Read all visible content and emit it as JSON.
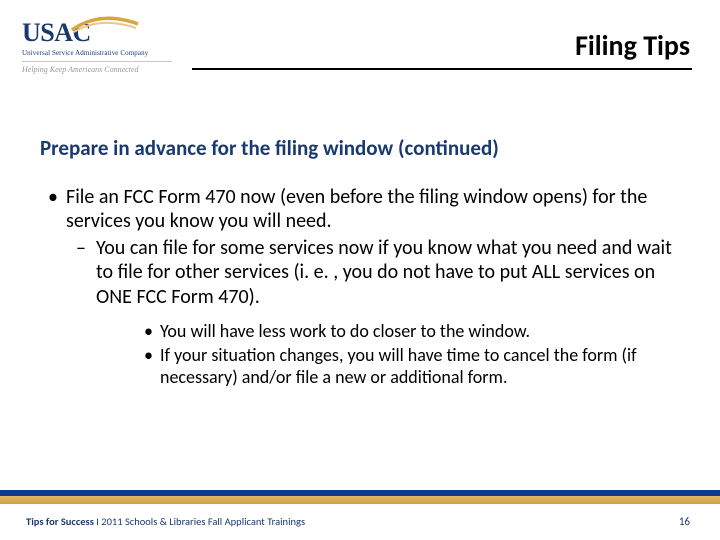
{
  "logo": {
    "name": "USAC",
    "subtitle": "Universal Service Administrative Company",
    "tagline": "Helping Keep Americans Connected"
  },
  "title": "Filing Tips",
  "heading": "Prepare in advance for the filing window (continued)",
  "bullets": {
    "l1": "File an FCC Form 470 now (even before the filing window opens) for the services you know you will need.",
    "l2": "You can file for some services now if you know what you need and wait to file for other services (i. e. , you do not have to put ALL services on ONE FCC Form 470).",
    "l3a": "You will have less work to do closer to the window.",
    "l3b": "If your situation changes, you will have time to cancel the form (if necessary) and/or file a new or additional form."
  },
  "footer": {
    "bold": "Tips for Success",
    "rest": "  I  2011 Schools & Libraries Fall Applicant Trainings",
    "page": "16"
  },
  "colors": {
    "brand_blue": "#1a3a6e",
    "gold": "#d9a441"
  }
}
